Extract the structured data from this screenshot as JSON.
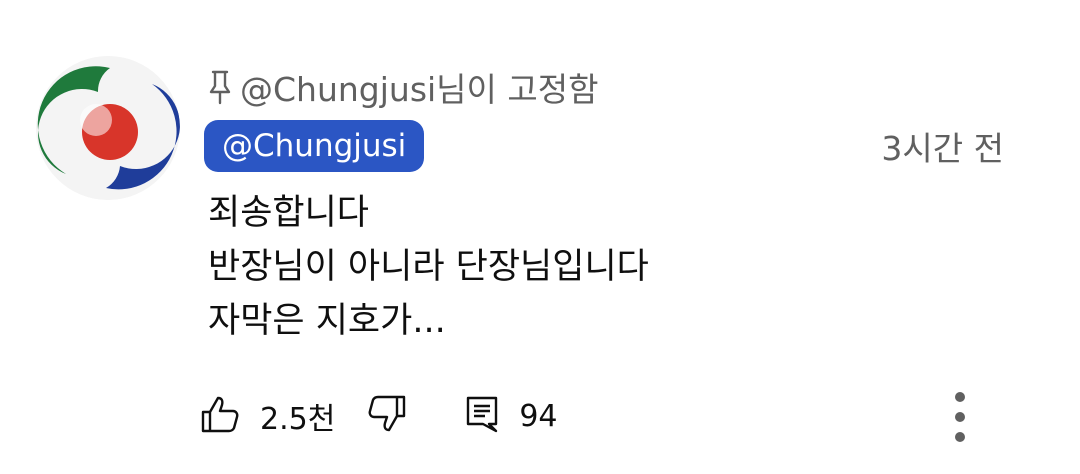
{
  "comment": {
    "pinned_by": "@Chungjusi님이 고정함",
    "author": "@Chungjusi",
    "timestamp": "3시간 전",
    "lines": [
      "죄송합니다",
      "반장님이 아니라 단장님입니다",
      "자막은 지호가..."
    ],
    "likes": "2.5천",
    "replies": "94"
  },
  "icons": {
    "pin": "pin-icon",
    "like": "thumbs-up-icon",
    "dislike": "thumbs-down-icon",
    "reply": "comment-icon",
    "more": "more-vert-icon"
  },
  "colors": {
    "author_chip_bg": "#2b56c4",
    "author_chip_text": "#ffffff",
    "secondary_text": "#606060",
    "primary_text": "#0f0f0f",
    "avatar_green": "#1f7a3c",
    "avatar_red": "#d8352a",
    "avatar_blue": "#1f3d9a"
  }
}
